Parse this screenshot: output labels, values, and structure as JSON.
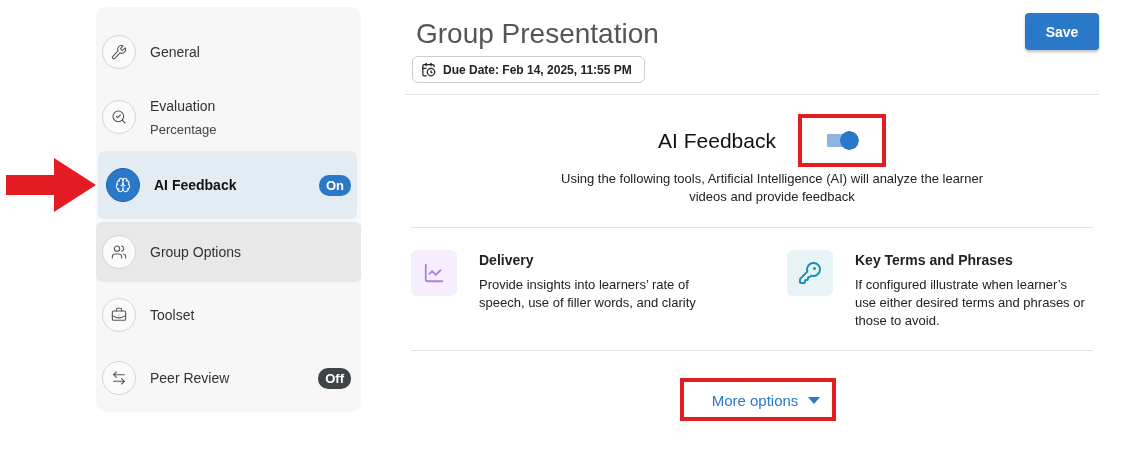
{
  "sidebar": {
    "items": [
      {
        "label": "General",
        "selected": false,
        "hovered": false,
        "pointed": false
      },
      {
        "label": "Evaluation",
        "subtitle": "Percentage",
        "selected": false,
        "hovered": false,
        "pointed": false
      },
      {
        "label": "AI Feedback",
        "selected": true,
        "hovered": false,
        "pointed": true,
        "badge": {
          "text": "On",
          "on": true
        }
      },
      {
        "label": "Group Options",
        "selected": false,
        "hovered": true,
        "pointed": false
      },
      {
        "label": "Toolset",
        "selected": false,
        "hovered": false,
        "pointed": false
      },
      {
        "label": "Peer Review",
        "selected": false,
        "hovered": false,
        "pointed": false,
        "badge": {
          "text": "Off",
          "on": false
        }
      }
    ]
  },
  "header": {
    "title": "Group Presentation",
    "save": "Save",
    "due_date": "Due Date: Feb 14, 2025, 11:55 PM"
  },
  "ai_feedback": {
    "title": "AI Feedback",
    "on": true,
    "highlighted": true,
    "description": "Using the following tools, Artificial Intelligence (AI) will analyze the learner videos and provide feedback"
  },
  "tools": [
    {
      "title": "Delivery",
      "description": "Provide insights into learners’ rate of speech, use of filler words, and clarity"
    },
    {
      "title": "Key Terms and Phrases",
      "description": "If configured illustrate when learner’s use either desired terms and phrases or those to avoid."
    }
  ],
  "more_options": {
    "label": "More options",
    "highlighted": true
  }
}
